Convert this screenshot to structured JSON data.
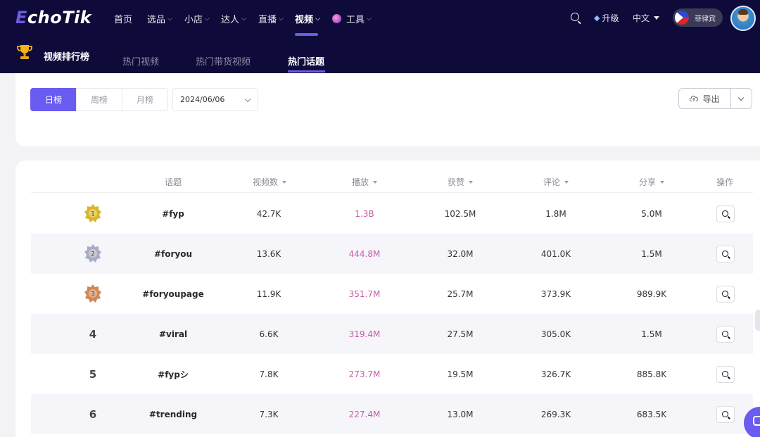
{
  "brand": {
    "logo_e": "E",
    "logo_rest": "choTik"
  },
  "nav": {
    "items": [
      {
        "label": "首页",
        "chevron": false
      },
      {
        "label": "选品",
        "chevron": true
      },
      {
        "label": "小店",
        "chevron": true
      },
      {
        "label": "达人",
        "chevron": true
      },
      {
        "label": "直播",
        "chevron": true
      },
      {
        "label": "视频",
        "chevron": true,
        "active": true
      },
      {
        "label": "工具",
        "chevron": true
      }
    ],
    "upgrade": "升级",
    "language": "中文",
    "region": "菲律宾"
  },
  "subnav": {
    "title": "视频排行榜",
    "tabs": [
      {
        "label": "热门视频",
        "active": false
      },
      {
        "label": "热门带货视频",
        "active": false
      },
      {
        "label": "热门话题",
        "active": true
      }
    ]
  },
  "filters": {
    "periods": [
      {
        "label": "日榜",
        "active": true
      },
      {
        "label": "周榜",
        "active": false
      },
      {
        "label": "月榜",
        "active": false
      }
    ],
    "date": "2024/06/06",
    "export": "导出"
  },
  "table": {
    "headers": {
      "topic": "话题",
      "videos": "视频数",
      "plays": "播放",
      "likes": "获赞",
      "comments": "评论",
      "shares": "分享",
      "action": "操作"
    },
    "rows": [
      {
        "rank": "1",
        "medal": "gold",
        "topic": "#fyp",
        "videos": "42.7K",
        "plays": "1.3B",
        "likes": "102.5M",
        "comments": "1.8M",
        "shares": "5.0M"
      },
      {
        "rank": "2",
        "medal": "silver",
        "topic": "#foryou",
        "videos": "13.6K",
        "plays": "444.8M",
        "likes": "32.0M",
        "comments": "401.0K",
        "shares": "1.5M"
      },
      {
        "rank": "3",
        "medal": "bronze",
        "topic": "#foryoupage",
        "videos": "11.9K",
        "plays": "351.7M",
        "likes": "25.7M",
        "comments": "373.9K",
        "shares": "989.9K"
      },
      {
        "rank": "4",
        "medal": "",
        "topic": "#viral",
        "videos": "6.6K",
        "plays": "319.4M",
        "likes": "27.5M",
        "comments": "305.0K",
        "shares": "1.5M"
      },
      {
        "rank": "5",
        "medal": "",
        "topic": "#fypシ",
        "videos": "7.8K",
        "plays": "273.7M",
        "likes": "19.5M",
        "comments": "326.7K",
        "shares": "885.8K"
      },
      {
        "rank": "6",
        "medal": "",
        "topic": "#trending",
        "videos": "7.3K",
        "plays": "227.4M",
        "likes": "13.0M",
        "comments": "269.3K",
        "shares": "683.5K"
      }
    ]
  },
  "colors": {
    "nav_bg": "#0e0b3a",
    "accent": "#6a5cf0",
    "plays_text": "#c75aa8",
    "gold": "#d9b52a",
    "silver": "#a9adc2",
    "bronze": "#d2875a"
  }
}
